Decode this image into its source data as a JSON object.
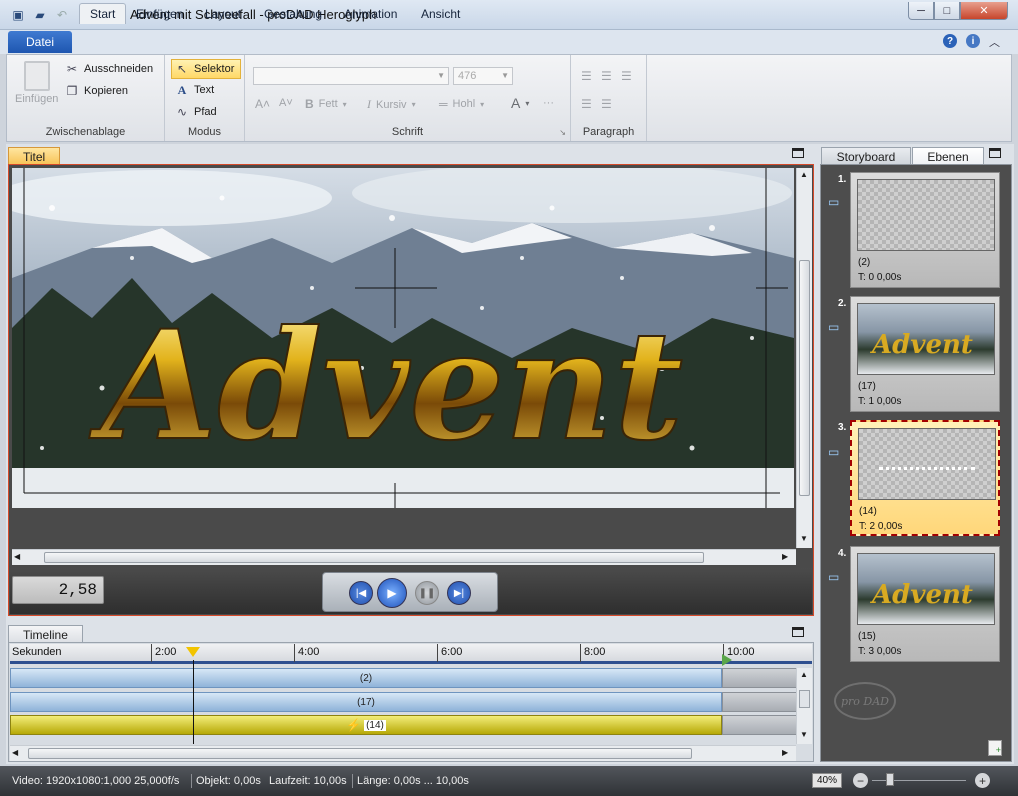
{
  "window": {
    "title": "Advent mit Schneefall - proDAD Heroglyph",
    "controls": {
      "minimize": "─",
      "maximize": "□",
      "close": "✕"
    }
  },
  "ribbon_tabs": {
    "file": "Datei",
    "tabs": [
      "Start",
      "Einfügen",
      "Layout",
      "Gestaltung",
      "Animation",
      "Ansicht"
    ],
    "active": "Start"
  },
  "ribbon": {
    "clipboard": {
      "label": "Zwischenablage",
      "paste": "Einfügen",
      "cut": "Ausschneiden",
      "copy": "Kopieren"
    },
    "mode": {
      "label": "Modus",
      "selector": "Selektor",
      "text": "Text",
      "path": "Pfad"
    },
    "font": {
      "label": "Schrift",
      "size_value": "476",
      "bold": "Fett",
      "italic": "Kursiv",
      "hollow": "Hohl"
    },
    "paragraph": {
      "label": "Paragraph"
    }
  },
  "canvas": {
    "tab": "Titel",
    "title_text": "Advent",
    "timecode": "2,58"
  },
  "timeline": {
    "tab": "Timeline",
    "ruler_label": "Sekunden",
    "ticks": [
      "2:00",
      "4:00",
      "6:00",
      "8:00",
      "10:00"
    ],
    "tracks": [
      {
        "label": "(2)",
        "style": "blue"
      },
      {
        "label": "(17)",
        "style": "blue"
      },
      {
        "label": "(14)",
        "style": "yellow"
      }
    ]
  },
  "right_panel": {
    "tabs": [
      "Storyboard",
      "Ebenen"
    ],
    "active_tab": "Ebenen",
    "layers": [
      {
        "num": "1.",
        "count": "(2)",
        "time": "T: 0  0,00s",
        "thumb": "checker"
      },
      {
        "num": "2.",
        "count": "(17)",
        "time": "T: 1  0,00s",
        "thumb": "advent"
      },
      {
        "num": "3.",
        "count": "(14)",
        "time": "T: 2  0,00s",
        "thumb": "checker",
        "selected": true
      },
      {
        "num": "4.",
        "count": "(15)",
        "time": "T: 3  0,00s",
        "thumb": "advent"
      }
    ],
    "logo": "pro DAD"
  },
  "status": {
    "video": "Video: 1920x1080:1,000  25,000f/s",
    "object": "Objekt: 0,00s",
    "runtime": "Laufzeit: 10,00s",
    "length": "Länge: 0,00s ... 10,00s",
    "zoom": "40%"
  },
  "colors": {
    "accent": "#1e56b0",
    "selection_border": "#d64a2a",
    "gold": "#e2b31c"
  }
}
